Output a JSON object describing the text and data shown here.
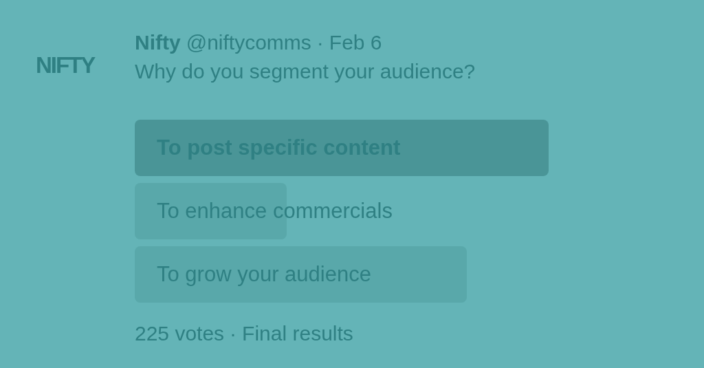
{
  "avatar": {
    "text": "NIFTY"
  },
  "tweet": {
    "name": "Nifty",
    "handle": "@niftycomms",
    "separator": "·",
    "date": "Feb 6",
    "text": "Why do you segment your audience?"
  },
  "poll": {
    "options": [
      {
        "label": "To post specific content",
        "selected": true
      },
      {
        "label": "To enhance commercials",
        "selected": false
      },
      {
        "label": "To grow your audience",
        "selected": false
      }
    ],
    "votes": "225 votes",
    "separator": "·",
    "status": "Final results"
  }
}
